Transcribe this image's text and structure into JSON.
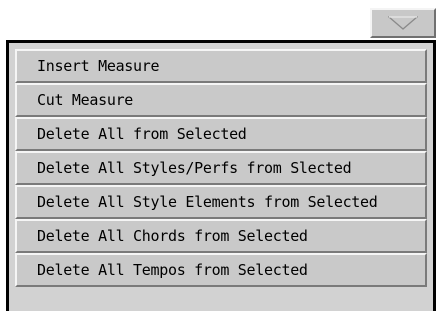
{
  "dropdown": {
    "icon": "triangle-down-icon"
  },
  "menu": {
    "items": [
      {
        "label": "Insert Measure"
      },
      {
        "label": "Cut Measure"
      },
      {
        "label": "Delete All from Selected"
      },
      {
        "label": "Delete All Styles/Perfs from Slected"
      },
      {
        "label": "Delete All Style Elements from Selected"
      },
      {
        "label": "Delete All Chords from Selected"
      },
      {
        "label": "Delete All Tempos from Selected"
      }
    ]
  },
  "colors": {
    "item_face": "#c9c9c9",
    "panel_bg": "#d2d2d2",
    "highlight": "#f5f5f5",
    "shadow": "#7a7a7a",
    "frame": "#000000"
  }
}
